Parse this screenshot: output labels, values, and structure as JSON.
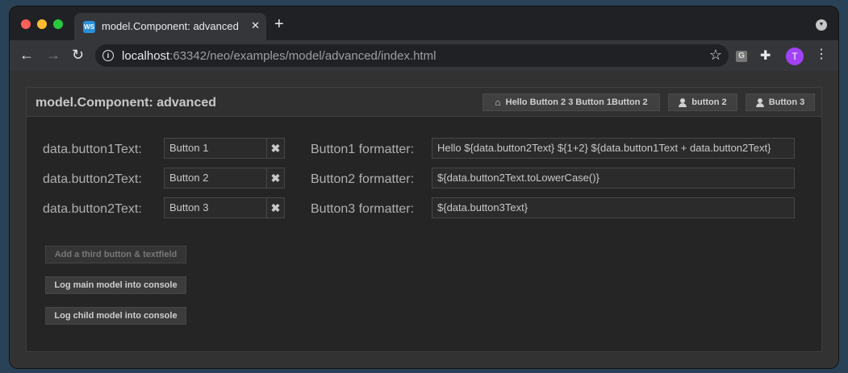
{
  "browser": {
    "tab_title": "model.Component: advanced",
    "tab_favicon": "webstorm-icon",
    "new_tab": "+",
    "url_host": "localhost",
    "url_rest": ":63342/neo/examples/model/advanced/index.html",
    "extension_label": "G",
    "profile_initial": "T"
  },
  "panel": {
    "title": "model.Component: advanced",
    "header_buttons": [
      {
        "label": "Hello Button 2 3 Button 1Button 2",
        "icon": "home-icon"
      },
      {
        "label": "button 2",
        "icon": "user-icon"
      },
      {
        "label": "Button 3",
        "icon": "user-icon"
      }
    ]
  },
  "form": {
    "rows": [
      {
        "label": "data.button1Text:",
        "value": "Button 1",
        "formatter_label": "Button1 formatter:",
        "formatter_value": "Hello ${data.button2Text} ${1+2} ${data.button1Text + data.button2Text}"
      },
      {
        "label": "data.button2Text:",
        "value": "Button 2",
        "formatter_label": "Button2 formatter:",
        "formatter_value": "${data.button2Text.toLowerCase()}"
      },
      {
        "label": "data.button2Text:",
        "value": "Button 3",
        "formatter_label": "Button3 formatter:",
        "formatter_value": "${data.button3Text}"
      }
    ],
    "clear_glyph": "✖"
  },
  "actions": [
    {
      "label": "Add a third button & textfield",
      "disabled": true
    },
    {
      "label": "Log main model into console",
      "disabled": false
    },
    {
      "label": "Log child model into console",
      "disabled": false
    }
  ],
  "colors": {
    "accent_profile": "#a142f4",
    "panel_bg": "#252525",
    "header_bg": "#303030"
  }
}
